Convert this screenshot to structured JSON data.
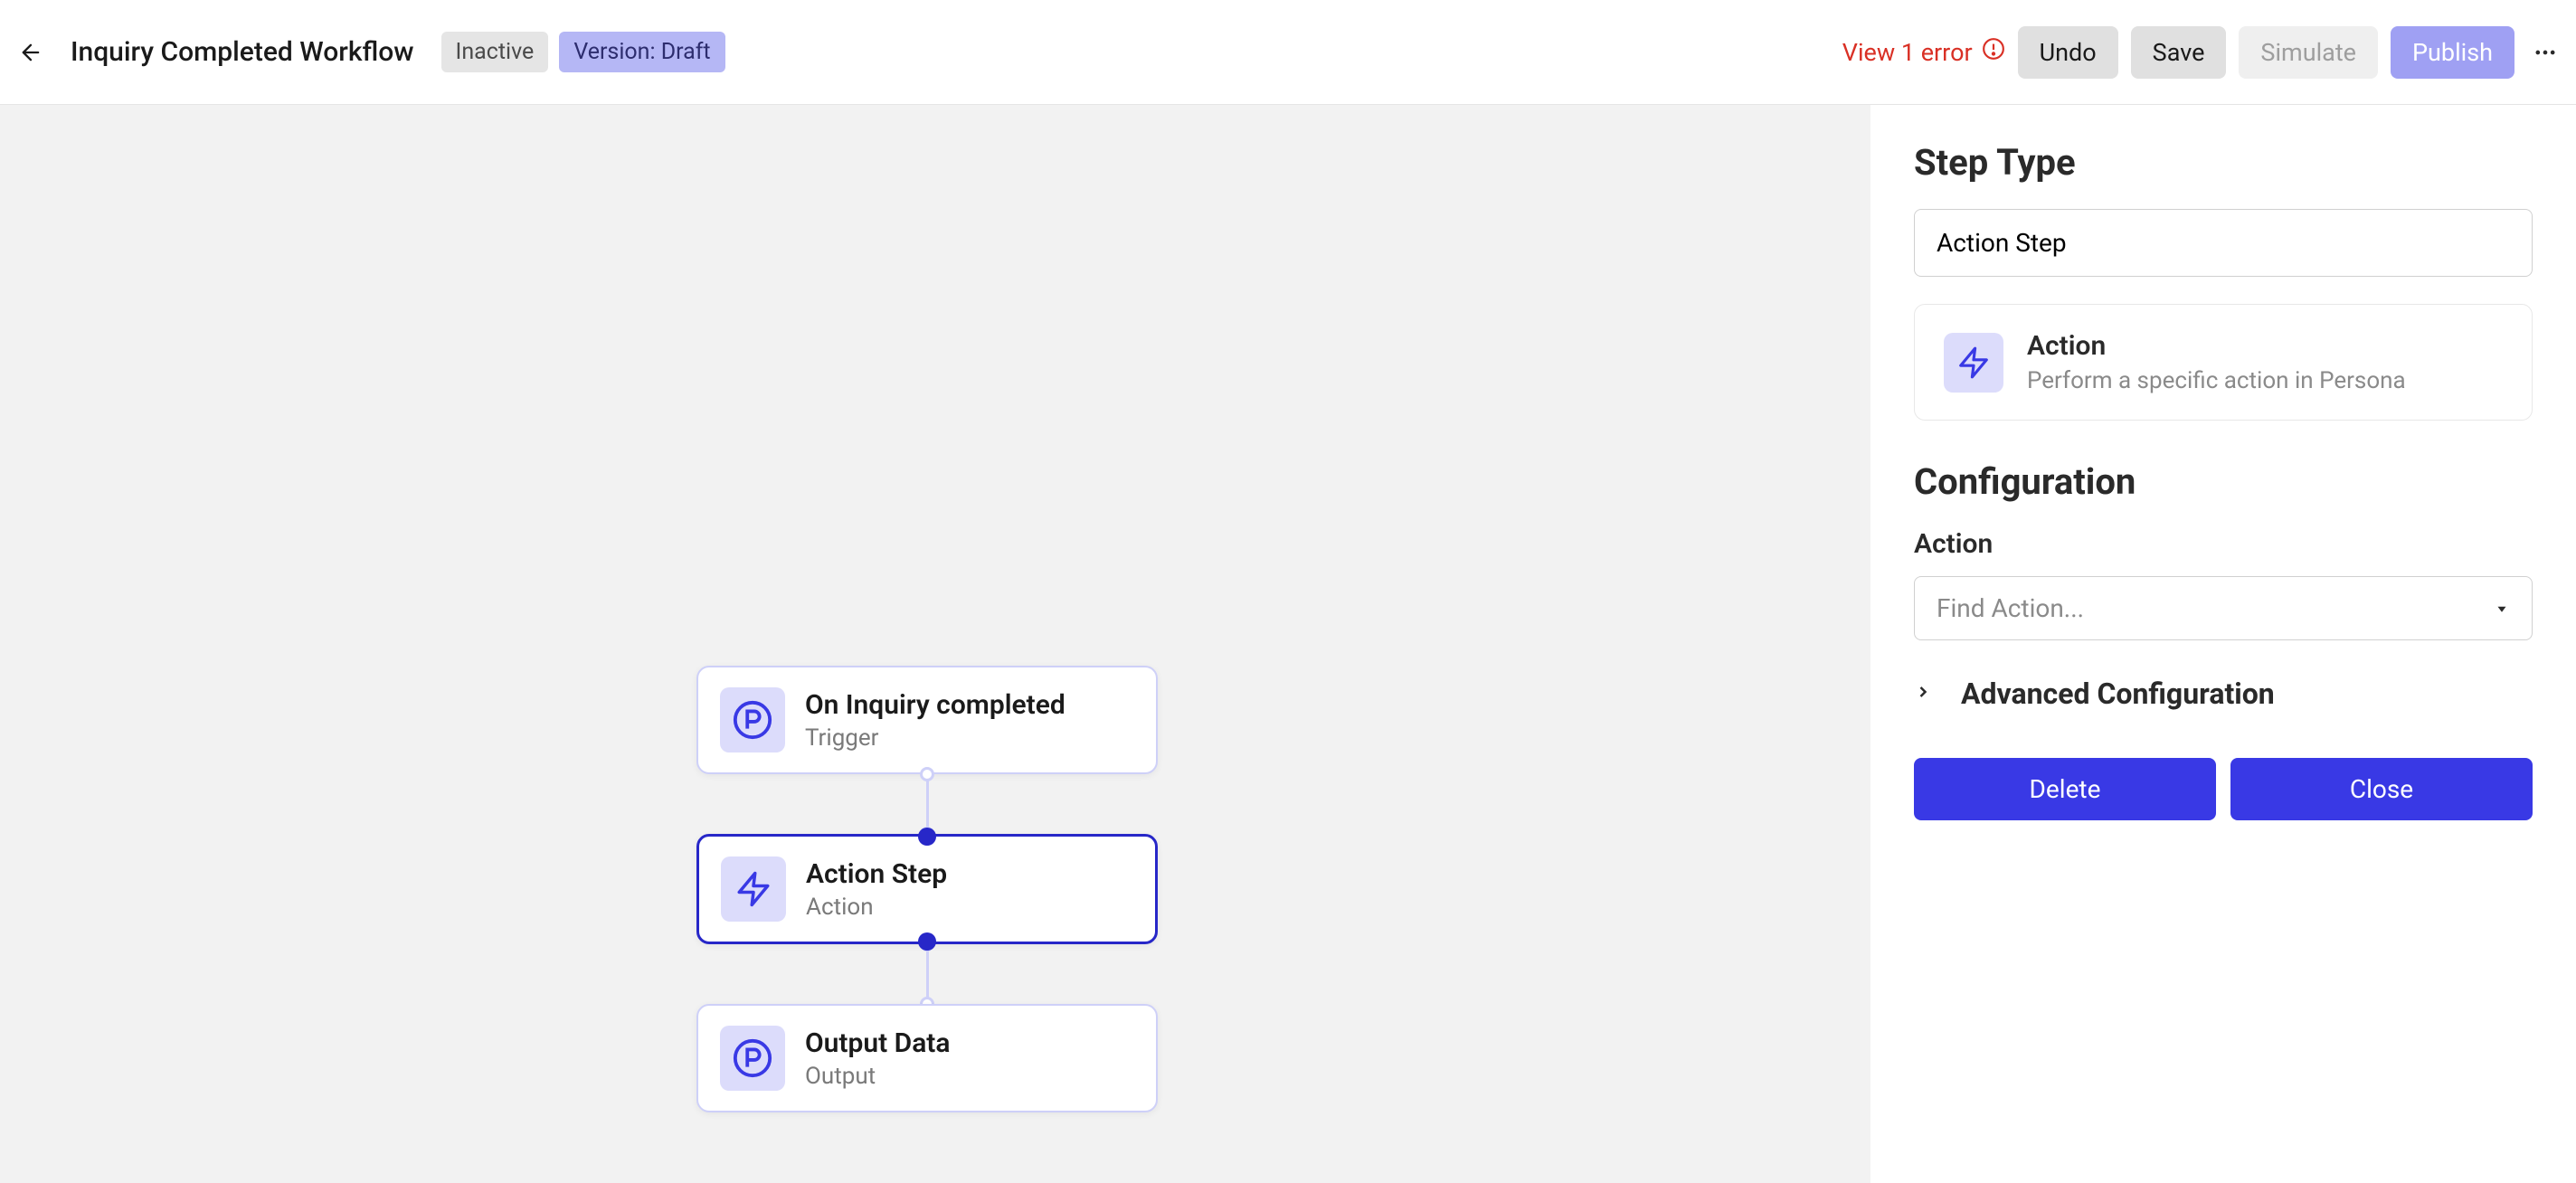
{
  "header": {
    "title": "Inquiry Completed Workflow",
    "status_badge": "Inactive",
    "version_badge": "Version: Draft",
    "error_text": "View 1 error",
    "undo_label": "Undo",
    "save_label": "Save",
    "simulate_label": "Simulate",
    "publish_label": "Publish"
  },
  "canvas": {
    "nodes": [
      {
        "title": "On Inquiry completed",
        "subtitle": "Trigger"
      },
      {
        "title": "Action Step",
        "subtitle": "Action"
      },
      {
        "title": "Output Data",
        "subtitle": "Output"
      }
    ]
  },
  "sidebar": {
    "step_type_heading": "Step Type",
    "step_type_value": "Action Step",
    "action_card": {
      "title": "Action",
      "desc": "Perform a specific action in Persona"
    },
    "config_heading": "Configuration",
    "action_label": "Action",
    "action_placeholder": "Find Action...",
    "advanced_label": "Advanced Configuration",
    "delete_label": "Delete",
    "close_label": "Close"
  }
}
